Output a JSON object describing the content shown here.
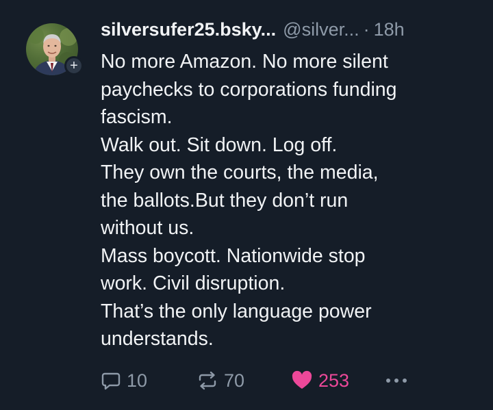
{
  "post": {
    "author": {
      "display_name": "silversufer25.bsky...",
      "handle": "@silver...",
      "timestamp": "18h"
    },
    "follow_badge": "+",
    "body_lines": [
      "No more Amazon. No more silent",
      "paychecks to corporations funding",
      "fascism.",
      "Walk out. Sit down. Log off.",
      "They own the courts, the media,",
      "the ballots.But they don’t run",
      "without us.",
      "Mass boycott. Nationwide stop",
      "work. Civil disruption.",
      "That’s the only language power",
      "understands."
    ],
    "actions": {
      "reply_count": "10",
      "repost_count": "70",
      "like_count": "253",
      "liked": true,
      "icons": [
        "reply-icon",
        "repost-icon",
        "heart-icon",
        "more-icon"
      ]
    }
  },
  "colors": {
    "background": "#151d28",
    "text": "#f1f3f5",
    "muted": "#8e9aa8",
    "like": "#ec4899"
  }
}
